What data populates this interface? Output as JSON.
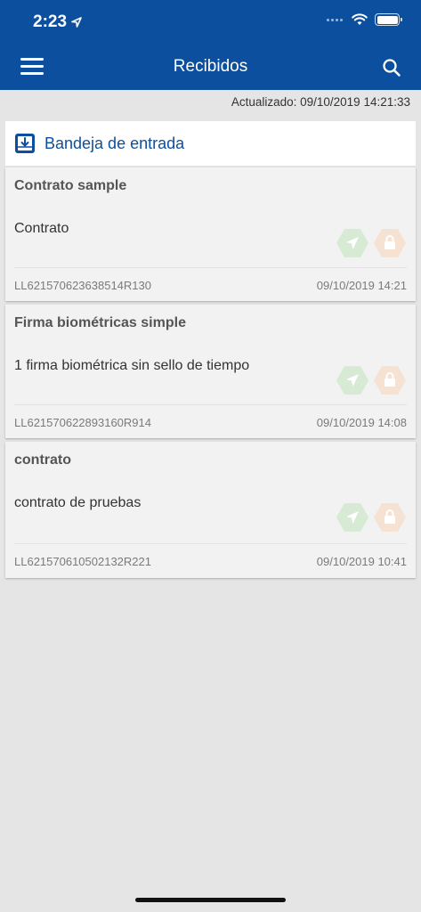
{
  "status_bar": {
    "time": "2:23"
  },
  "nav": {
    "title": "Recibidos"
  },
  "updated": "Actualizado: 09/10/2019 14:21:33",
  "inbox": {
    "title": "Bandeja de entrada"
  },
  "documents": [
    {
      "title": "Contrato sample",
      "description": "Contrato",
      "id": "LL621570623638514R130",
      "date": "09/10/2019 14:21"
    },
    {
      "title": "Firma biométricas simple",
      "description": "1 firma biométrica sin sello de tiempo",
      "id": "LL621570622893160R914",
      "date": "09/10/2019 14:08"
    },
    {
      "title": "contrato",
      "description": "contrato de pruebas",
      "id": "LL621570610502132R221",
      "date": "09/10/2019 10:41"
    }
  ],
  "colors": {
    "brand": "#0b4f9e",
    "send_icon": "#d6ead4",
    "lock_icon": "#f6e2d2"
  },
  "icons": {
    "menu": "hamburger-icon",
    "search": "search-icon",
    "inbox": "inbox-download-icon",
    "send": "send-icon",
    "lock": "lock-icon"
  }
}
